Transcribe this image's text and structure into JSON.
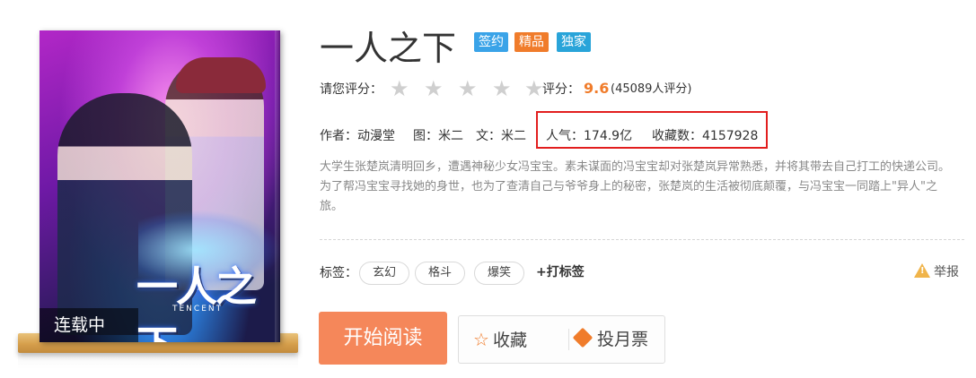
{
  "cover": {
    "status": "连载中",
    "logo_text": "一人之下",
    "logo_sub": "TENCENT"
  },
  "book": {
    "title": "一人之下",
    "badges": [
      "签约",
      "精品",
      "独家"
    ]
  },
  "rating": {
    "label": "请您评分：",
    "stars": 5,
    "score_label": "评分：",
    "score": "9.6",
    "count": "(45089人评分)"
  },
  "meta": {
    "author": "作者：动漫堂",
    "art": "图：米二",
    "text": "文：米二",
    "popularity": "人气：174.9亿",
    "favorites": "收藏数：4157928"
  },
  "description": "大学生张楚岚清明回乡，遭遇神秘少女冯宝宝。素未谋面的冯宝宝却对张楚岚异常熟悉，并将其带去自己打工的快递公司。为了帮冯宝宝寻找她的身世，也为了查清自己与爷爷身上的秘密，张楚岚的生活被彻底颠覆，与冯宝宝一同踏上\"异人\"之旅。",
  "tags": {
    "label": "标签：",
    "items": [
      "玄幻",
      "格斗",
      "爆笑"
    ],
    "add_label": "打标签"
  },
  "report": {
    "label": "举报"
  },
  "actions": {
    "read": "开始阅读",
    "collect": "收藏",
    "vote": "投月票"
  },
  "colors": {
    "accent": "#f07c2b",
    "read_button": "#f5875a",
    "highlight": "#e21e1e"
  }
}
